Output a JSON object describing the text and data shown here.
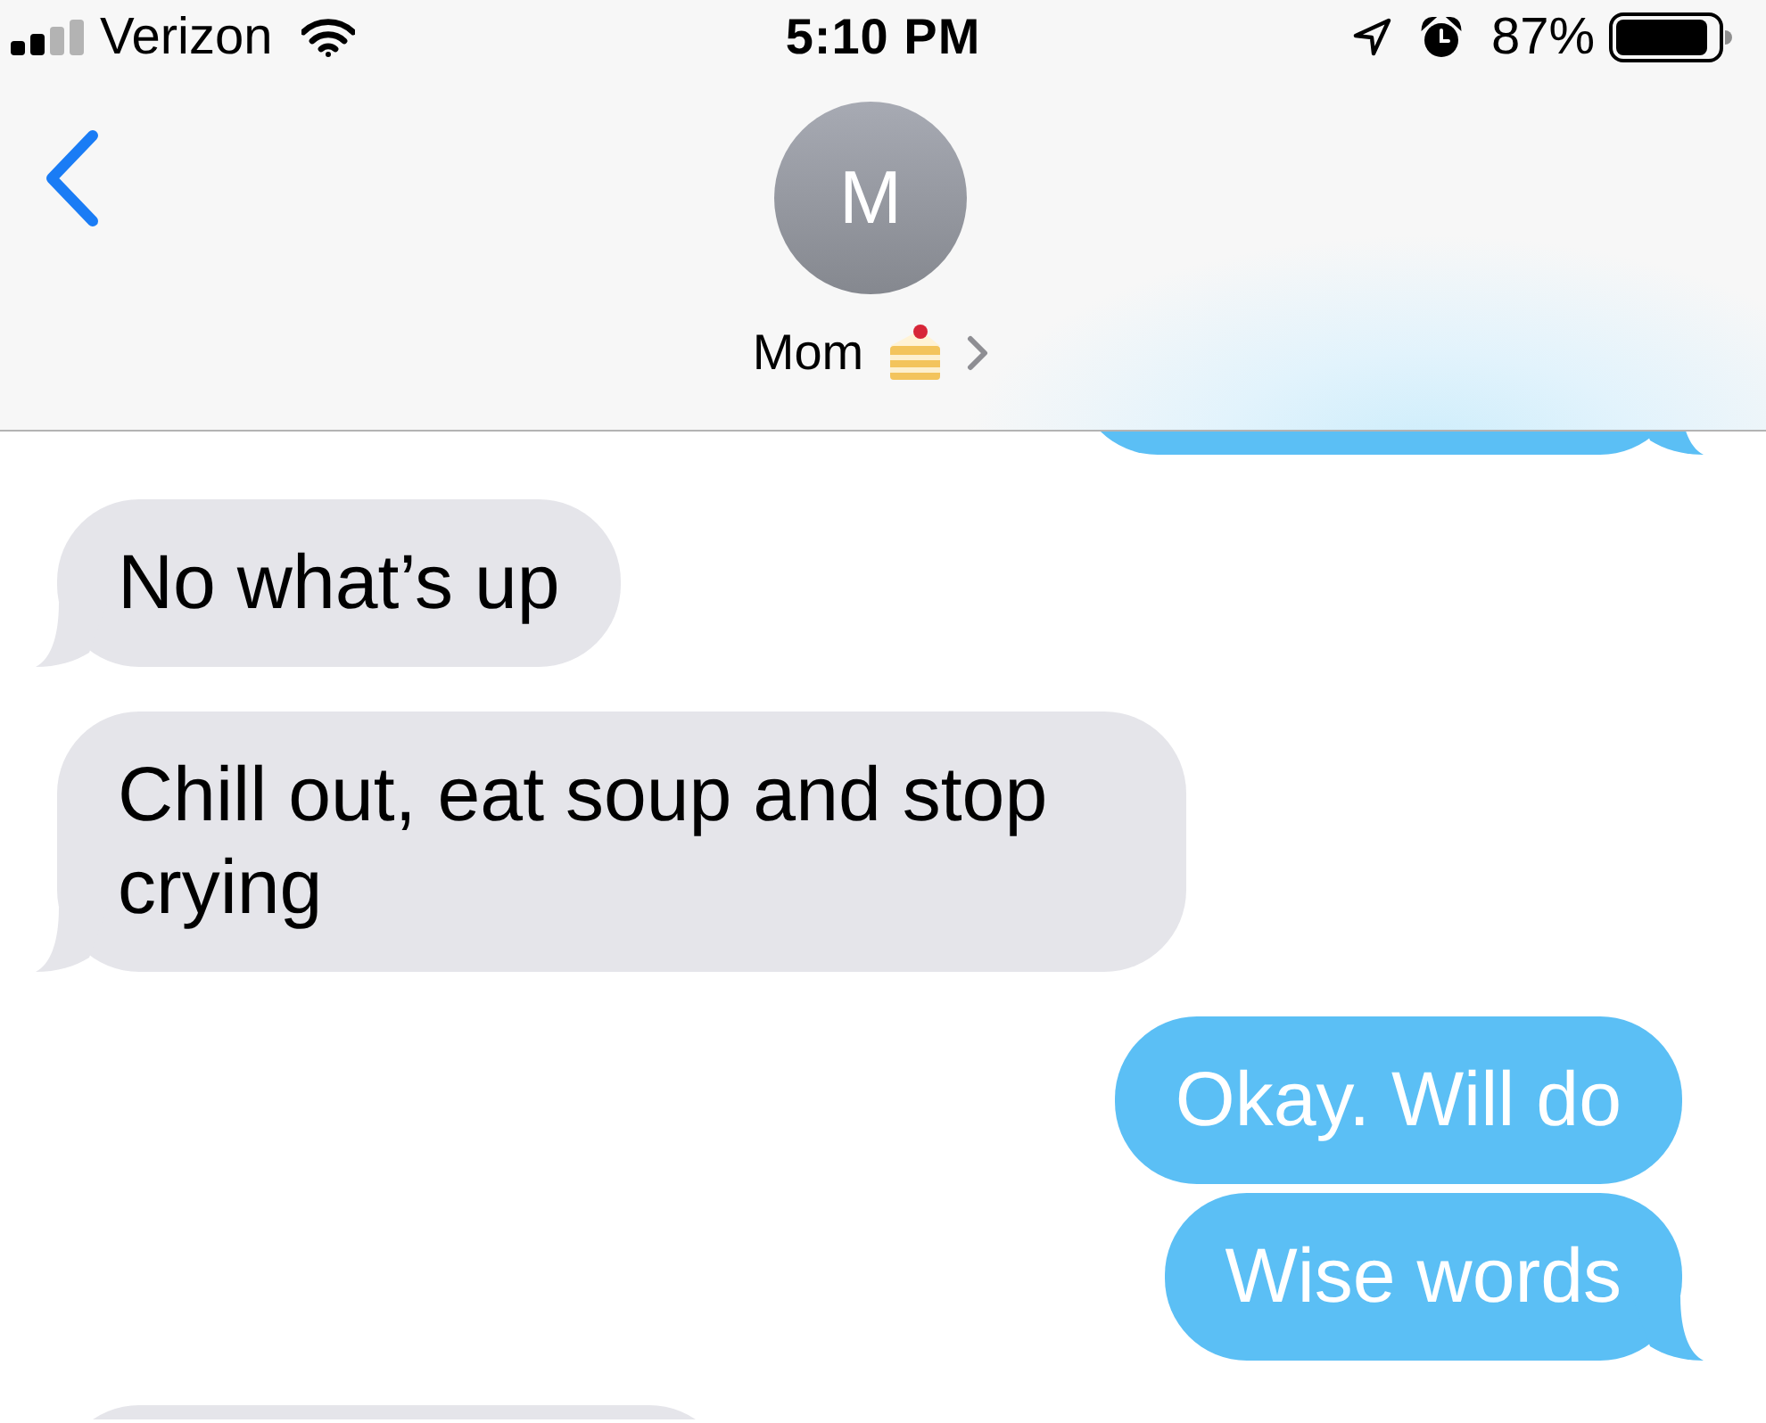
{
  "status_bar": {
    "carrier": "Verizon",
    "time": "5:10 PM",
    "battery_percent": "87%"
  },
  "header": {
    "avatar_initial": "M",
    "contact_name": "Mom"
  },
  "messages": [
    {
      "kind": "sent",
      "tail": true,
      "partial": true
    },
    {
      "kind": "received",
      "text": "No what’s up",
      "tail": true,
      "partial": false
    },
    {
      "kind": "received",
      "text": "Chill out, eat soup and stop crying",
      "tail": true,
      "partial": false
    },
    {
      "kind": "sent",
      "text": "Okay. Will do",
      "tail": false,
      "partial": false
    },
    {
      "kind": "sent",
      "text": "Wise words",
      "tail": true,
      "partial": false
    },
    {
      "kind": "received",
      "tail": false,
      "partial": true
    }
  ]
}
